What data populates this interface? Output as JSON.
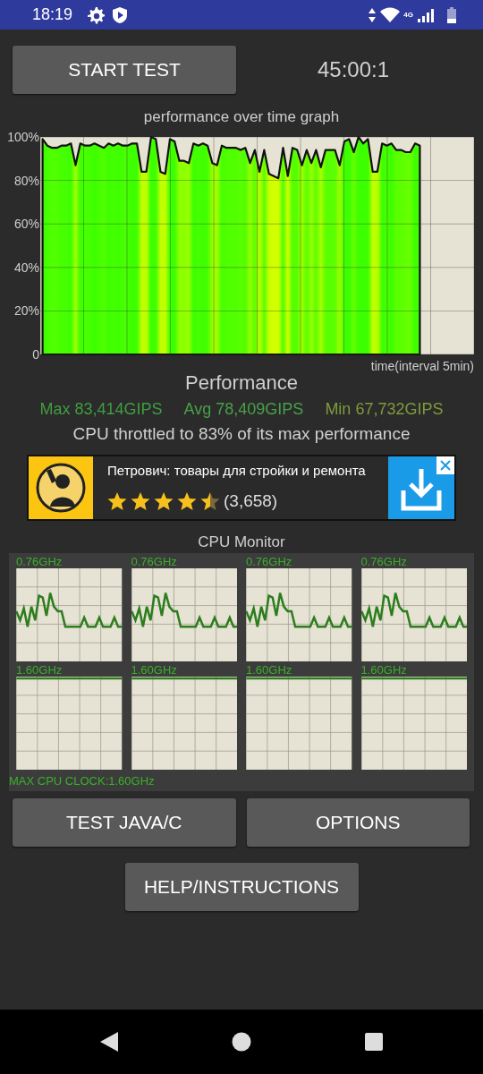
{
  "status_bar": {
    "time": "18:19",
    "network": "4G"
  },
  "start_button": "START TEST",
  "timer": "45:00:1",
  "graph": {
    "chart_data": {
      "type": "area",
      "title": "performance over time graph",
      "xlabel": "time(interval 5min)",
      "ylim": [
        0,
        100
      ],
      "grid": true,
      "categories": [
        null,
        null,
        null,
        null,
        null,
        null,
        null,
        null,
        null,
        null,
        null,
        null,
        null,
        null,
        null,
        null,
        null,
        null,
        null,
        null,
        null,
        null,
        null,
        null,
        null,
        null,
        null,
        null,
        null,
        null,
        null,
        null,
        null,
        null,
        null,
        null,
        null,
        null,
        null,
        null,
        null,
        null,
        null,
        null,
        null,
        null,
        null,
        null,
        null,
        null,
        null,
        null,
        null,
        null,
        null,
        null,
        null,
        null,
        null,
        null,
        null,
        null,
        null,
        null,
        null,
        null,
        null,
        null,
        null,
        null,
        null,
        null,
        null,
        null,
        null,
        null,
        null,
        null,
        null,
        null,
        null,
        null,
        null,
        null,
        null,
        null,
        null,
        null,
        null,
        null,
        null,
        null
      ],
      "yticks": [
        {
          "value": 0,
          "label": "0"
        },
        {
          "value": 20,
          "label": "20%"
        },
        {
          "value": 40,
          "label": "40%"
        },
        {
          "value": 60,
          "label": "60%"
        },
        {
          "value": 80,
          "label": "80%"
        },
        {
          "value": 100,
          "label": "100%"
        }
      ],
      "series": [
        {
          "color": "#111111",
          "values": [
            99,
            96,
            95,
            95,
            96,
            96,
            97,
            87,
            97,
            96,
            96,
            97,
            96,
            95,
            97,
            96,
            97,
            96,
            96,
            97,
            97,
            84,
            84,
            100,
            99,
            84,
            83,
            99,
            98,
            89,
            89,
            88,
            97,
            96,
            97,
            96,
            88,
            87,
            96,
            95,
            95,
            95,
            94,
            95,
            88,
            94,
            84,
            94,
            83,
            82,
            81,
            95,
            82,
            95,
            94,
            87,
            94,
            88,
            94,
            86,
            94,
            94,
            94,
            87,
            98,
            99,
            93,
            100,
            97,
            99,
            84,
            84,
            97,
            96,
            97,
            94,
            94,
            93,
            93,
            97,
            96,
            null,
            null,
            null,
            null,
            null,
            null,
            null,
            null,
            null,
            null,
            null
          ]
        }
      ]
    }
  },
  "performance": {
    "title": "Performance",
    "max": "Max 83,414GIPS",
    "avg": "Avg 78,409GIPS",
    "min": "Min 67,732GIPS",
    "throttle_text": "CPU throttled to 83% of its max performance"
  },
  "ad": {
    "title": "Петрович: товары для стройки и ремонта",
    "stars": 4.5,
    "rating_count": "(3,658)"
  },
  "cpu_monitor": {
    "title": "CPU Monitor",
    "cores": [
      {
        "clock": "0.76GHz",
        "kind": "fluctuating"
      },
      {
        "clock": "0.76GHz",
        "kind": "fluctuating"
      },
      {
        "clock": "0.76GHz",
        "kind": "fluctuating"
      },
      {
        "clock": "0.76GHz",
        "kind": "fluctuating"
      },
      {
        "clock": "1.60GHz",
        "kind": "full"
      },
      {
        "clock": "1.60GHz",
        "kind": "full"
      },
      {
        "clock": "1.60GHz",
        "kind": "full"
      },
      {
        "clock": "1.60GHz",
        "kind": "full"
      }
    ],
    "max_clock_label": "MAX CPU CLOCK:1.60GHz"
  },
  "buttons": [
    "TEST JAVA/C",
    "OPTIONS",
    "HELP/INSTRUCTIONS"
  ]
}
